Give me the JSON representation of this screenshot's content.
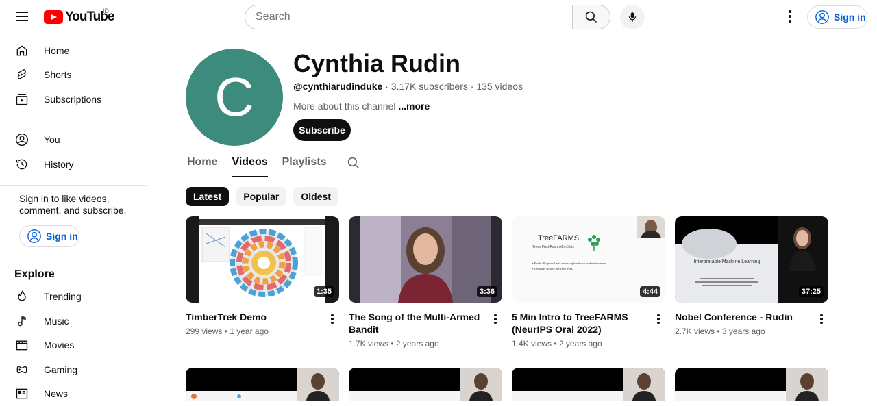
{
  "header": {
    "logo_text": "YouTube",
    "country_code": "ID",
    "search_placeholder": "Search",
    "sign_in": "Sign in"
  },
  "sidebar": {
    "main": [
      {
        "label": "Home",
        "icon": "home-icon"
      },
      {
        "label": "Shorts",
        "icon": "shorts-icon"
      },
      {
        "label": "Subscriptions",
        "icon": "subscriptions-icon"
      }
    ],
    "you": [
      {
        "label": "You",
        "icon": "account-icon"
      },
      {
        "label": "History",
        "icon": "history-icon"
      }
    ],
    "signin_note": "Sign in to like videos, comment, and subscribe.",
    "sign_in": "Sign in",
    "explore_title": "Explore",
    "explore": [
      {
        "label": "Trending",
        "icon": "trending-icon"
      },
      {
        "label": "Music",
        "icon": "music-icon"
      },
      {
        "label": "Movies",
        "icon": "movies-icon"
      },
      {
        "label": "Gaming",
        "icon": "gaming-icon"
      },
      {
        "label": "News",
        "icon": "news-icon"
      }
    ]
  },
  "channel": {
    "avatar_letter": "C",
    "avatar_color": "#3d8b7c",
    "name": "Cynthia Rudin",
    "handle": "@cynthiarudinduke",
    "subscribers": "3.17K subscribers",
    "videos": "135 videos",
    "about": "More about this channel",
    "about_more": "...more",
    "subscribe": "Subscribe"
  },
  "tabs": [
    "Home",
    "Videos",
    "Playlists"
  ],
  "chips": [
    "Latest",
    "Popular",
    "Oldest"
  ],
  "videos": [
    {
      "title": "TimberTrek Demo",
      "views": "299 views",
      "age": "1 year ago",
      "duration": "1:35"
    },
    {
      "title": "The Song of the Multi-Armed Bandit",
      "views": "1.7K views",
      "age": "2 years ago",
      "duration": "3:36"
    },
    {
      "title": "5 Min Intro to TreeFARMS (NeurIPS Oral 2022)",
      "views": "1.4K views",
      "age": "2 years ago",
      "duration": "4:44",
      "slide_title": "TreeFARMS",
      "slide_subtitle": "Trees FAst RashoMon Sets",
      "slide_bullets": [
        "• Finds all optimal and almost-optimal sparse decision trees.",
        "• Let users choose between trees."
      ]
    },
    {
      "title": "Nobel Conference - Rudin",
      "views": "2.7K views",
      "age": "3 years ago",
      "duration": "37:25",
      "slide_title": "Interpretable Machine Learning"
    }
  ],
  "colors": {
    "brand": "#ff0000",
    "link": "#065fd4"
  }
}
